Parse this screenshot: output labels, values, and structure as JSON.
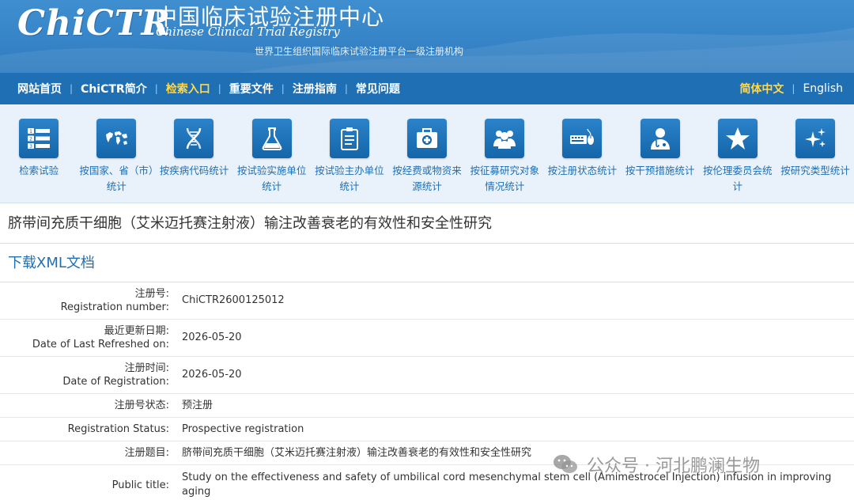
{
  "header": {
    "logo_text": "ChiCTR",
    "cn_title": "中国临床试验注册中心",
    "en_title": "Chinese Clinical Trial Registry",
    "tagline": "世界卫生组织国际临床试验注册平台一级注册机构"
  },
  "nav": {
    "items": [
      {
        "label": "网站首页",
        "active": false
      },
      {
        "label": "ChiCTR简介",
        "active": false
      },
      {
        "label": "检索入口",
        "active": true
      },
      {
        "label": "重要文件",
        "active": false
      },
      {
        "label": "注册指南",
        "active": false
      },
      {
        "label": "常见问题",
        "active": false
      }
    ],
    "lang_cn": "简体中文",
    "lang_en": "English",
    "separator": "|"
  },
  "icons": [
    {
      "label": "检索试验",
      "icon": "numbered-list-icon"
    },
    {
      "label": "按国家、省（市）统计",
      "icon": "world-map-icon"
    },
    {
      "label": "按疾病代码统计",
      "icon": "dna-icon"
    },
    {
      "label": "按试验实施单位统计",
      "icon": "flask-icon"
    },
    {
      "label": "按试验主办单位统计",
      "icon": "clipboard-icon"
    },
    {
      "label": "按经费或物资来源统计",
      "icon": "medkit-icon"
    },
    {
      "label": "按征募研究对象情况统计",
      "icon": "group-icon"
    },
    {
      "label": "按注册状态统计",
      "icon": "keyboard-mouse-icon"
    },
    {
      "label": "按干预措施统计",
      "icon": "doctor-icon"
    },
    {
      "label": "按伦理委员会统计",
      "icon": "star-icon"
    },
    {
      "label": "按研究类型统计",
      "icon": "sparkle-icon"
    }
  ],
  "study": {
    "title": "脐带间充质干细胞（艾米迈托赛注射液）输注改善衰老的有效性和安全性研究",
    "xml_link": "下载XML文档"
  },
  "fields": [
    {
      "label_cn": "注册号:",
      "label_en": "Registration number:",
      "value": "ChiCTR2600125012"
    },
    {
      "label_cn": "最近更新日期:",
      "label_en": "Date of Last Refreshed on:",
      "value": "2026-05-20"
    },
    {
      "label_cn": "注册时间:",
      "label_en": "Date of Registration:",
      "value": "2026-05-20"
    },
    {
      "label_cn": "注册号状态:",
      "label_en": "",
      "value": "预注册"
    },
    {
      "label_cn": "Registration Status:",
      "label_en": "",
      "value": "Prospective registration"
    },
    {
      "label_cn": "注册题目:",
      "label_en": "",
      "value": "脐带间充质干细胞（艾米迈托赛注射液）输注改善衰老的有效性和安全性研究"
    },
    {
      "label_cn": "Public title:",
      "label_en": "",
      "value": "Study on the effectiveness and safety of umbilical cord mesenchymal stem cell (Amimestrocel Injection) infusion in improving aging"
    }
  ],
  "watermark": {
    "text": "公众号 · 河北鹏澜生物",
    "icon": "wechat-icon"
  },
  "colors": {
    "banner": "#2f7cc0",
    "nav": "#1f6fb5",
    "active_nav": "#ffd94a",
    "icon_bg": "#1f6fb5",
    "link": "#1f6fb5"
  }
}
